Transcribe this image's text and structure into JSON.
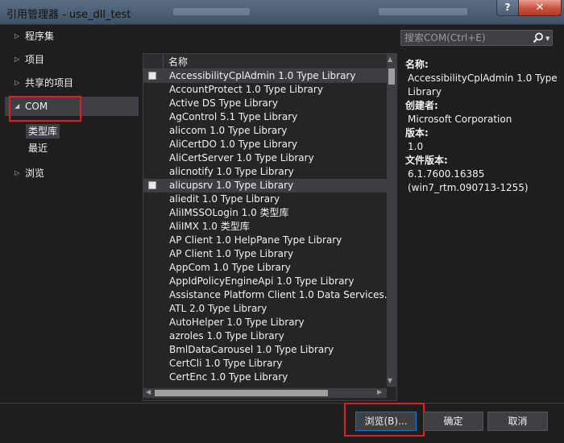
{
  "window": {
    "title": "引用管理器 - use_dll_test",
    "help_label": "?",
    "close_label": "✕"
  },
  "nav": {
    "items": [
      {
        "label": "程序集",
        "arrow": "▷"
      },
      {
        "label": "项目",
        "arrow": "▷"
      },
      {
        "label": "共享的项目",
        "arrow": "▷"
      },
      {
        "label": "COM",
        "arrow": "◢"
      },
      {
        "label": "浏览",
        "arrow": "▷"
      }
    ],
    "com_sub": [
      {
        "label": "类型库"
      },
      {
        "label": "最近"
      }
    ]
  },
  "list": {
    "column_header": "名称",
    "rows": [
      "AccessibilityCplAdmin 1.0 Type Library",
      "AccountProtect 1.0 Type Library",
      "Active DS Type Library",
      "AgControl 5.1 Type Library",
      "aliccom 1.0 Type Library",
      "AliCertDO 1.0 Type Library",
      "AliCertServer 1.0 Type Library",
      "alicnotify 1.0 Type Library",
      "alicupsrv 1.0 Type Library",
      "aliedit 1.0 Type Library",
      "AliIMSSOLogin 1.0 类型库",
      "AliIMX 1.0 类型库",
      "AP Client 1.0 HelpPane Type Library",
      "AP Client 1.0 Type Library",
      "AppCom 1.0 Type Library",
      "AppIdPolicyEngineApi 1.0 Type Library",
      "Assistance Platform Client 1.0 Data Services...",
      "ATL 2.0 Type Library",
      "AutoHelper 1.0 Type Library",
      "azroles 1.0 Type Library",
      "BmlDataCarousel 1.0 Type Library",
      "CertCli 1.0 Type Library",
      "CertEnc 1.0 Type Library"
    ]
  },
  "search": {
    "placeholder": "搜索COM(Ctrl+E)"
  },
  "details": {
    "name_label": "名称:",
    "name_value": "AccessibilityCplAdmin 1.0 Type Library",
    "creator_label": "创建者:",
    "creator_value": "Microsoft Corporation",
    "version_label": "版本:",
    "version_value": "1.0",
    "file_version_label": "文件版本:",
    "file_version_value": "6.1.7600.16385",
    "file_version_extra": "(win7_rtm.090713-1255)"
  },
  "buttons": {
    "browse": "浏览(B)...",
    "ok": "确定",
    "cancel": "取消"
  }
}
